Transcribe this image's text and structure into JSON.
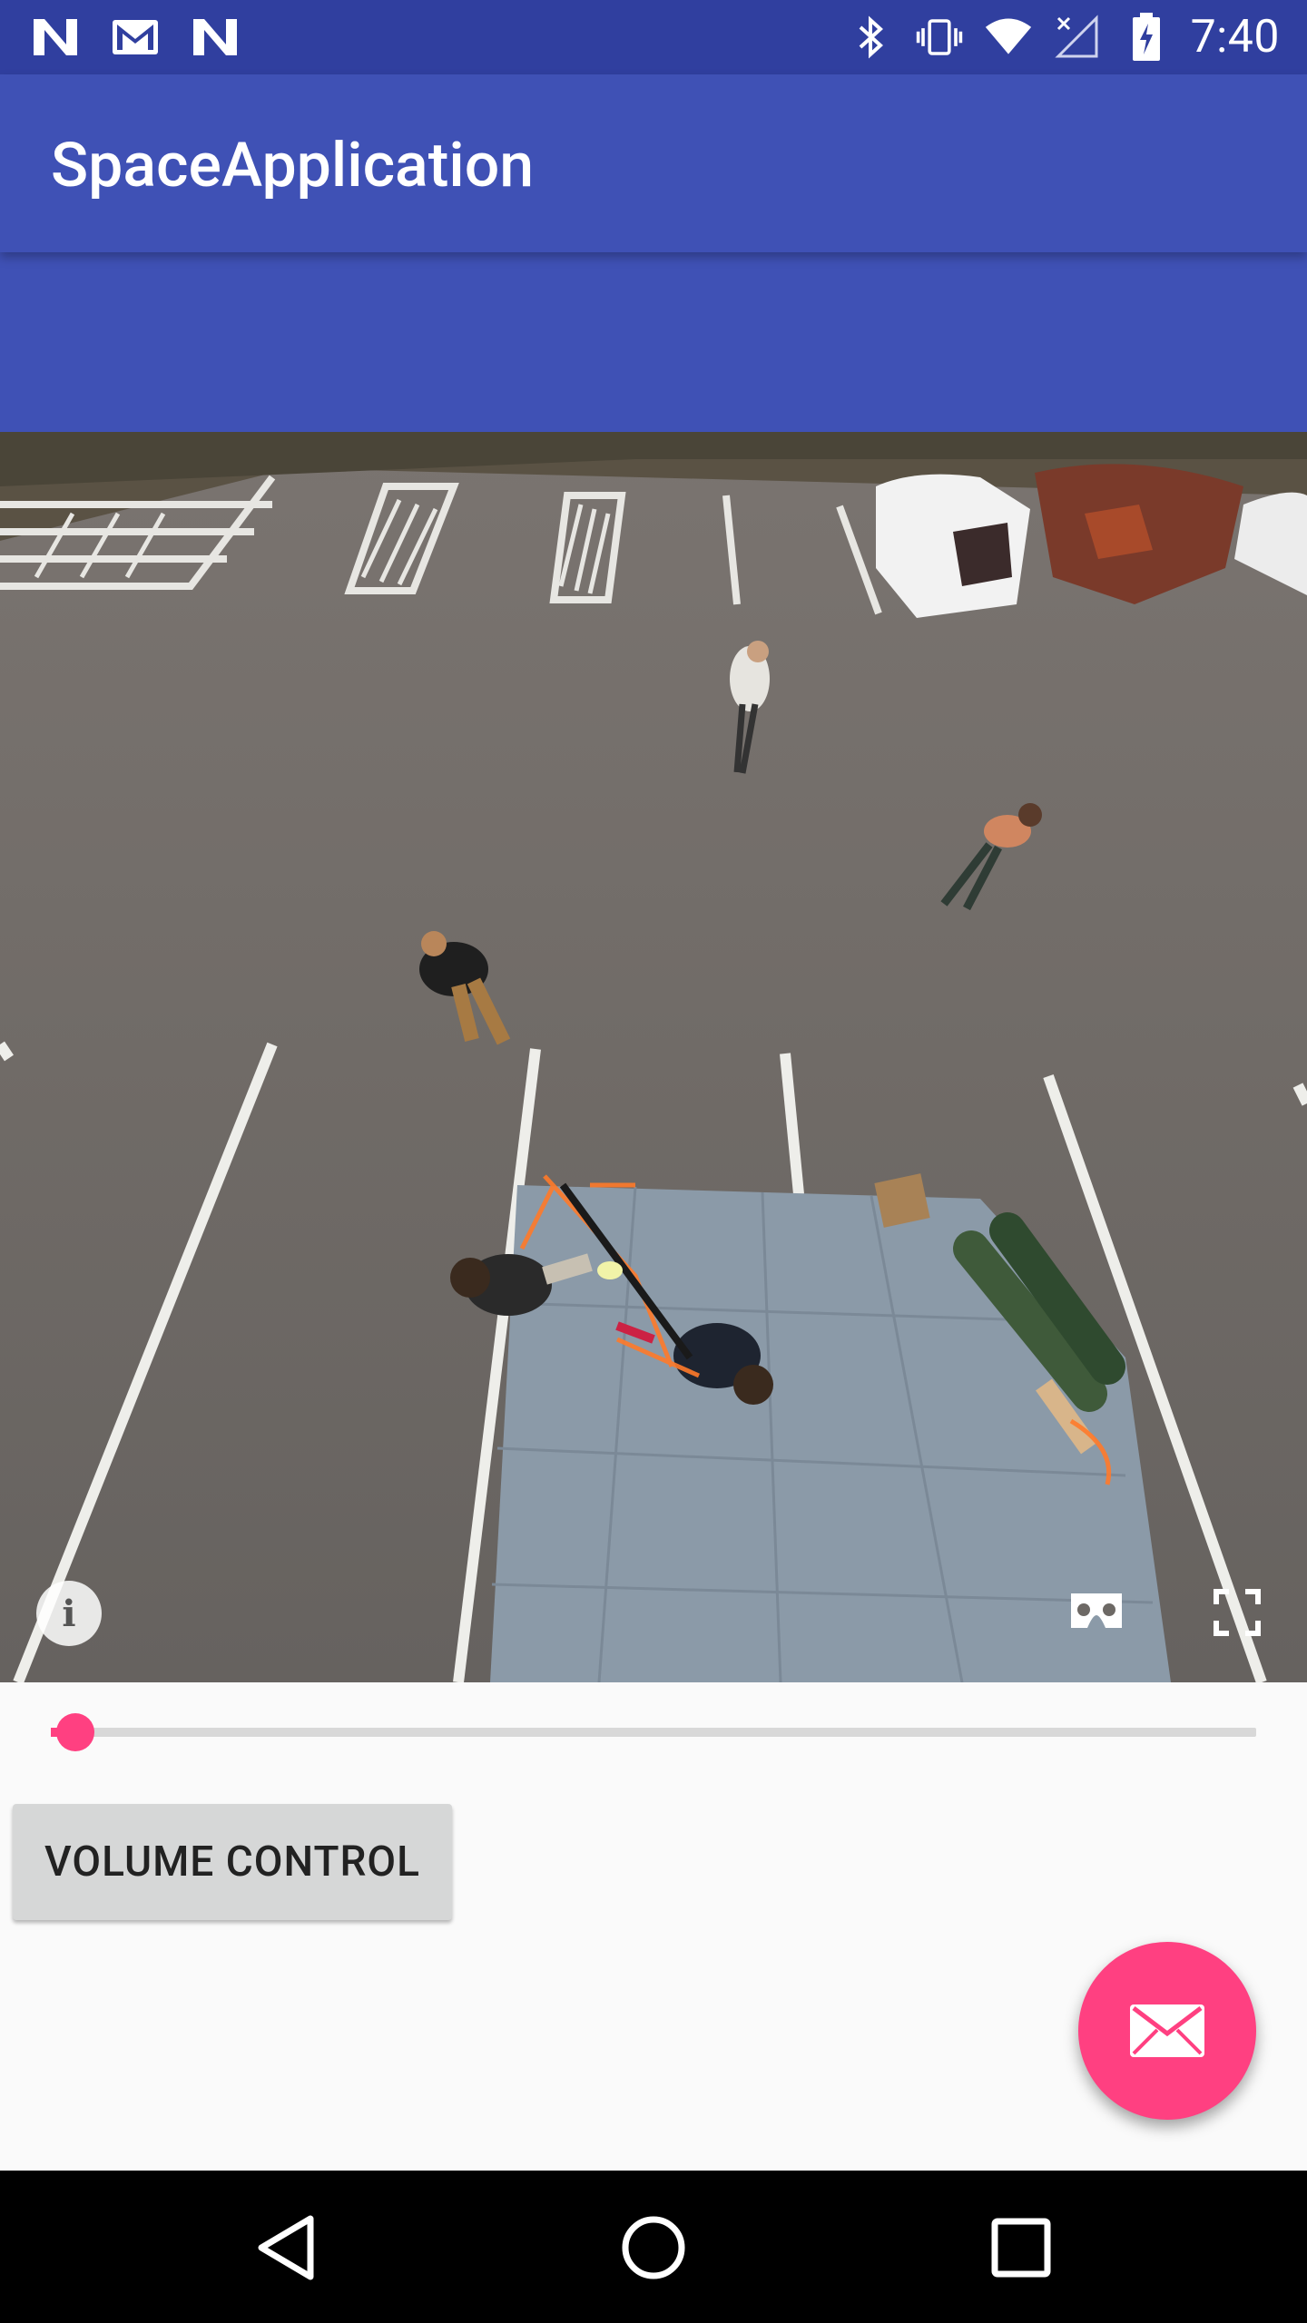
{
  "status_bar": {
    "time": "7:40",
    "left_icons": [
      "notification-n-icon",
      "gmail-icon",
      "notification-n-icon"
    ],
    "right_icons": [
      "bluetooth-icon",
      "vibrate-icon",
      "wifi-icon",
      "no-signal-icon",
      "battery-icon"
    ]
  },
  "app_bar": {
    "title": "SpaceApplication"
  },
  "video": {
    "content": "360 video",
    "info_icon": "info-icon",
    "vr_icon": "cardboard-vr-icon",
    "fullscreen_icon": "fullscreen-icon"
  },
  "seek_bar": {
    "progress_fraction": 0.02
  },
  "volume_button": {
    "label": "VOLUME CONTROL"
  },
  "fab": {
    "icon": "email-icon"
  },
  "colors": {
    "primary": "#3f51b5",
    "primary_dark": "#303f9f",
    "accent": "#ff4081"
  },
  "nav_bar": {
    "icons": [
      "back-icon",
      "home-icon",
      "recents-icon"
    ]
  }
}
